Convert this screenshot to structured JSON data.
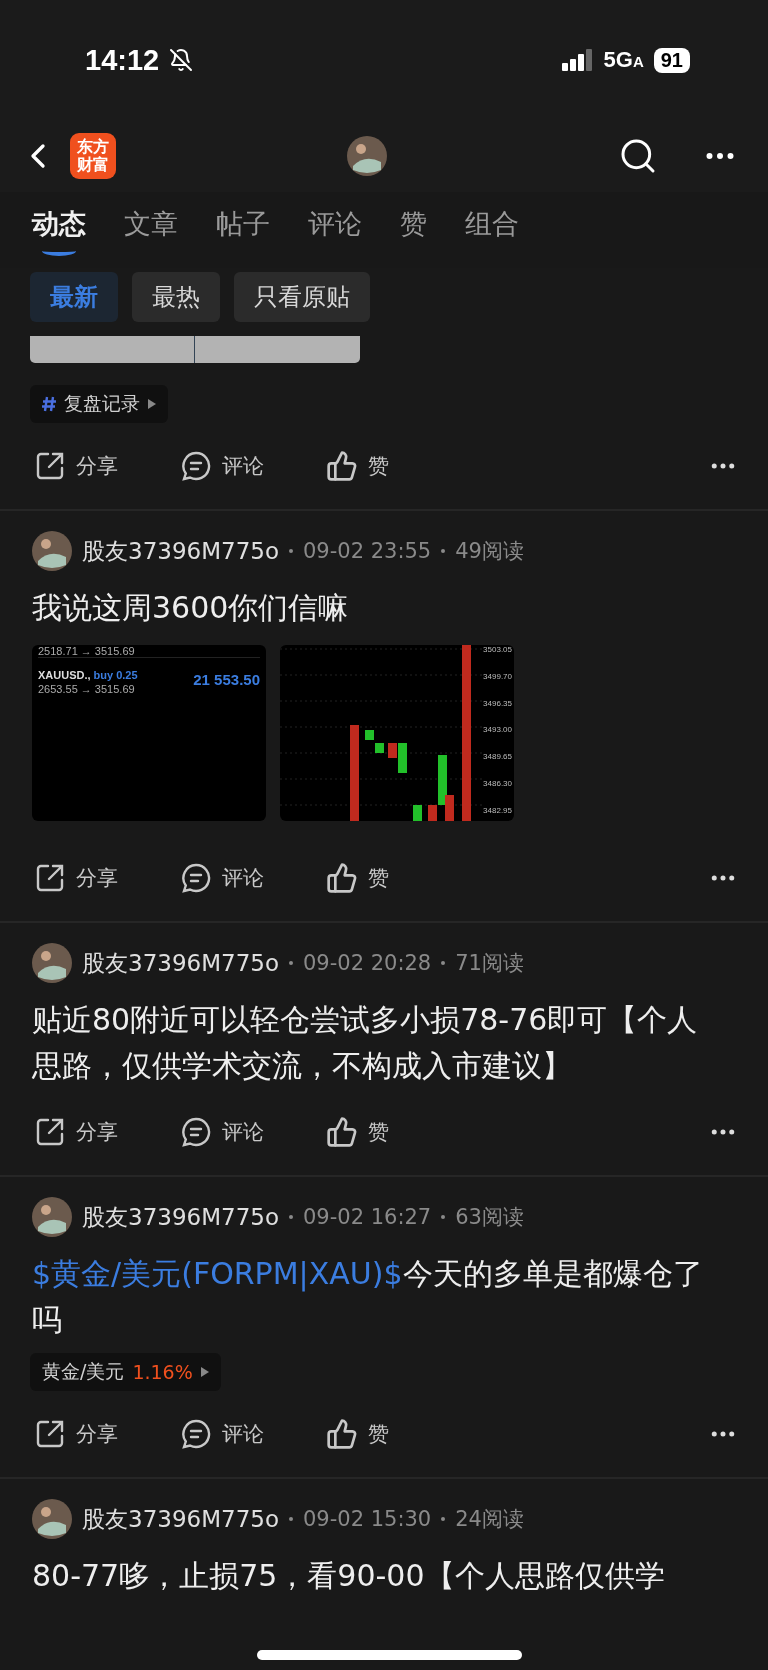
{
  "status_bar": {
    "time": "14:12",
    "network": "5G",
    "network_suffix": "A",
    "battery": "91"
  },
  "nav": {
    "logo_lines": [
      "东方",
      "财富"
    ]
  },
  "tabs": [
    {
      "label": "动态",
      "selected": true
    },
    {
      "label": "文章",
      "selected": false
    },
    {
      "label": "帖子",
      "selected": false
    },
    {
      "label": "评论",
      "selected": false
    },
    {
      "label": "赞",
      "selected": false
    },
    {
      "label": "组合",
      "selected": false
    }
  ],
  "filters": [
    {
      "label": "最新",
      "selected": true
    },
    {
      "label": "最热",
      "selected": false
    },
    {
      "label": "只看原贴",
      "selected": false
    }
  ],
  "prev_post": {
    "topic": "复盘记录",
    "actions": [
      "分享",
      "评论",
      "赞"
    ]
  },
  "posts": [
    {
      "user": "股友37396M775o",
      "time": "09-02 23:55",
      "reads": "49阅读",
      "text": [
        {
          "kind": "text",
          "s": "我说这周3600你们信嘛"
        }
      ],
      "trade_shot": {
        "row_1": "2518.71 → 3515.69",
        "symbol": "XAUUSD.,",
        "side": "buy 0.25",
        "row_2": "2653.55 → 3515.69",
        "profit": "21 553.50"
      },
      "chart_shot": {
        "price_ticks": [
          "3503.05",
          "3499.70",
          "3496.35",
          "3493.00",
          "3489.65",
          "3486.30",
          "3482.95"
        ]
      },
      "actions": [
        "分享",
        "评论",
        "赞"
      ]
    },
    {
      "user": "股友37396M775o",
      "time": "09-02 20:28",
      "reads": "71阅读",
      "text": [
        {
          "kind": "text",
          "s": "贴近80附近可以轻仓尝试多小损78-76即可【个人思路，仅供学术交流，不构成入市建议】"
        }
      ],
      "actions": [
        "分享",
        "评论",
        "赞"
      ]
    },
    {
      "user": "股友37396M775o",
      "time": "09-02 16:27",
      "reads": "63阅读",
      "text": [
        {
          "kind": "link",
          "s": "$黄金/美元(FORPM|XAU)$"
        },
        {
          "kind": "text",
          "s": "今天的多单是都爆仓了吗"
        }
      ],
      "stock_tag": {
        "name": "黄金/美元",
        "change": "1.16%"
      },
      "actions": [
        "分享",
        "评论",
        "赞"
      ]
    },
    {
      "user": "股友37396M775o",
      "time": "09-02 15:30",
      "reads": "24阅读",
      "text": [
        {
          "kind": "text",
          "s": "80-77哆，止损75，看90-00【个人思路仅供学"
        }
      ]
    }
  ]
}
